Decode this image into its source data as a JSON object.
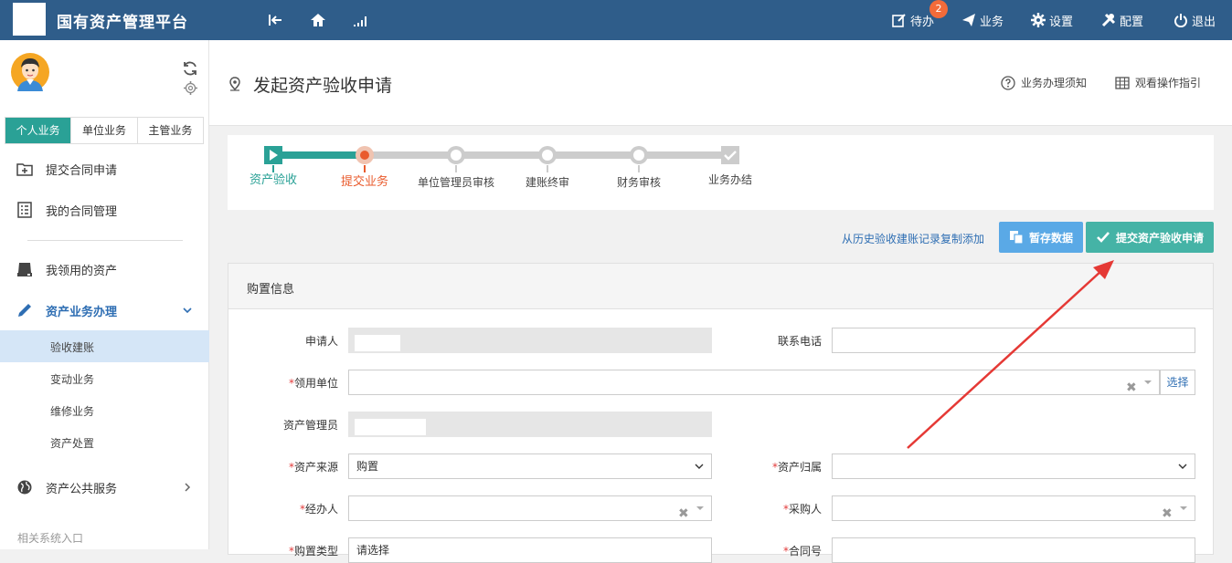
{
  "topbar": {
    "title": "国有资产管理平台",
    "nav": [
      {
        "label": "待办",
        "icon": "edit-icon"
      },
      {
        "label": "业务",
        "icon": "paper-plane-icon"
      },
      {
        "label": "设置",
        "icon": "gear-icon"
      },
      {
        "label": "配置",
        "icon": "wrench-icon"
      },
      {
        "label": "退出",
        "icon": "power-icon"
      }
    ],
    "badge_count": "2"
  },
  "sidebar": {
    "tabs": [
      "个人业务",
      "单位业务",
      "主管业务"
    ],
    "menu": [
      {
        "label": "提交合同申请",
        "icon": "add-folder-icon"
      },
      {
        "label": "我的合同管理",
        "icon": "document-list-icon"
      },
      {
        "label": "我领用的资产",
        "icon": "drive-icon"
      },
      {
        "label": "资产业务办理",
        "icon": "pencil-icon"
      },
      {
        "label": "资产公共服务",
        "icon": "globe-icon"
      }
    ],
    "submenu": [
      "验收建账",
      "变动业务",
      "维修业务",
      "资产处置"
    ],
    "related": "相关系统入口"
  },
  "header": {
    "title": "发起资产验收申请",
    "links": [
      {
        "label": "业务办理须知",
        "icon": "question-circle-icon"
      },
      {
        "label": "观看操作指引",
        "icon": "grid-table-icon"
      }
    ]
  },
  "steps": [
    {
      "label": "资产验收",
      "status": "done"
    },
    {
      "label": "提交业务",
      "status": "current"
    },
    {
      "label": "单位管理员审核",
      "status": "pending"
    },
    {
      "label": "建账终审",
      "status": "pending"
    },
    {
      "label": "财务审核",
      "status": "pending"
    },
    {
      "label": "业务办结",
      "status": "pending"
    }
  ],
  "actions": {
    "copy_link": "从历史验收建账记录复制添加",
    "save": "暂存数据",
    "submit": "提交资产验收申请"
  },
  "form": {
    "section_title": "购置信息",
    "required_mark": "*",
    "choose": "选择",
    "fields": {
      "applicant": {
        "label": "申请人",
        "value": ""
      },
      "phone": {
        "label": "联系电话",
        "value": ""
      },
      "unit": {
        "label": "领用单位",
        "value": "",
        "required": true
      },
      "asset_admin": {
        "label": "资产管理员",
        "value": ""
      },
      "source": {
        "label": "资产来源",
        "value": "购置",
        "required": true
      },
      "ownership": {
        "label": "资产归属",
        "value": "",
        "required": true
      },
      "handler": {
        "label": "经办人",
        "value": "",
        "required": true
      },
      "purchaser": {
        "label": "采购人",
        "value": "",
        "required": true
      },
      "purchase_type": {
        "label": "购置类型",
        "value": "请选择",
        "required": true
      },
      "contract_no": {
        "label": "合同号",
        "value": "",
        "required": true
      }
    }
  },
  "colors": {
    "topbar": "#2f5d8a",
    "accent": "#2aa196",
    "current_step": "#e95b2d",
    "link": "#2e6eb3",
    "arrow": "#e53935"
  }
}
